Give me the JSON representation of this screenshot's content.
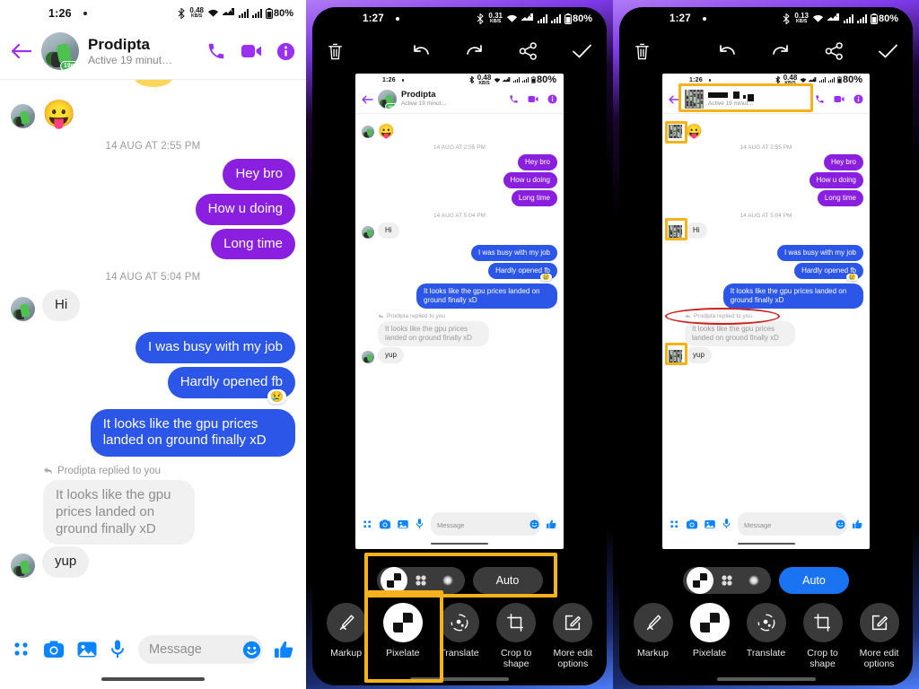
{
  "panels": {
    "left": {
      "name": "messenger-chat-fullscreen",
      "status_bar": {
        "time": "1:26",
        "net_speed": "0.48",
        "net_unit": "KB/S",
        "battery": "80%"
      },
      "header": {
        "contact_name": "Prodipta",
        "active_status": "Active 19 minut…",
        "avatar_badge": "19m",
        "back_icon": "back-arrow-icon",
        "call_icon": "phone-call-icon",
        "video_icon": "video-call-icon",
        "info_icon": "info-icon"
      },
      "messages": [
        {
          "type": "emoji",
          "side": "in",
          "text": "😛"
        },
        {
          "type": "timestamp",
          "text": "14 AUG AT 2:55 PM"
        },
        {
          "type": "bubble",
          "side": "out",
          "color": "purple",
          "text": "Hey bro"
        },
        {
          "type": "bubble",
          "side": "out",
          "color": "purple",
          "text": "How u doing"
        },
        {
          "type": "bubble",
          "side": "out",
          "color": "purple",
          "text": "Long time"
        },
        {
          "type": "timestamp",
          "text": "14 AUG AT 5:04 PM"
        },
        {
          "type": "bubble",
          "side": "in",
          "color": "grey",
          "text": "Hi"
        },
        {
          "type": "bubble",
          "side": "out",
          "color": "blue",
          "text": "I was busy with my job"
        },
        {
          "type": "bubble",
          "side": "out",
          "color": "blue",
          "text": "Hardly opened fb",
          "reaction": "😢"
        },
        {
          "type": "bubble",
          "side": "out",
          "color": "blue",
          "text": "It looks like the gpu prices landed on ground finally xD"
        },
        {
          "type": "reply_label",
          "text": "Prodipta replied to you"
        },
        {
          "type": "bubble",
          "side": "in",
          "color": "quoted",
          "text": "It looks like the gpu prices landed on ground finally xD"
        },
        {
          "type": "bubble",
          "side": "in",
          "color": "grey",
          "text": "yup"
        }
      ],
      "composer": {
        "placeholder": "Message",
        "apps_icon": "apps-grid-icon",
        "camera_icon": "camera-icon",
        "gallery_icon": "gallery-image-icon",
        "mic_icon": "microphone-icon",
        "sticker_icon": "smiley-sticker-icon",
        "like_icon": "thumbs-up-icon"
      }
    },
    "middle": {
      "name": "photo-editor-pixelate-tool-selected",
      "status_bar": {
        "time": "1:27",
        "net_speed": "0.31",
        "net_unit": "KB/S",
        "battery": "80%"
      },
      "toolbar": {
        "delete_icon": "trash-can-icon",
        "undo_icon": "undo-arrow-icon",
        "redo_icon": "redo-arrow-icon",
        "share_icon": "share-nodes-icon",
        "done_icon": "checkmark-icon"
      },
      "style_options": [
        {
          "name": "mosaic-block-style",
          "selected": true
        },
        {
          "name": "dots-cluster-style",
          "selected": false
        },
        {
          "name": "blur-dot-style",
          "selected": false
        }
      ],
      "auto_button": {
        "label": "Auto",
        "active": false
      },
      "tools": [
        {
          "label": "Markup",
          "icon": "pen-markup-icon",
          "selected": false
        },
        {
          "label": "Pixelate",
          "icon": "pixelate-blocks-icon",
          "selected": true
        },
        {
          "label": "Translate",
          "icon": "translate-lens-icon",
          "selected": false
        },
        {
          "label": "Crop to shape",
          "icon": "crop-shape-icon",
          "selected": false
        },
        {
          "label": "More edit options",
          "icon": "edit-square-pencil-icon",
          "selected": false
        }
      ],
      "annotations": [
        {
          "type": "highlight-box",
          "name": "highlight-style-selector"
        },
        {
          "type": "highlight-box",
          "name": "highlight-pixelate-tool"
        }
      ]
    },
    "right": {
      "name": "photo-editor-pixelate-applied",
      "status_bar": {
        "time": "1:27",
        "net_speed": "0.13",
        "net_unit": "KB/S",
        "battery": "80%"
      },
      "toolbar": {
        "delete_icon": "trash-can-icon",
        "undo_icon": "undo-arrow-icon",
        "redo_icon": "redo-arrow-icon",
        "share_icon": "share-nodes-icon",
        "done_icon": "checkmark-icon"
      },
      "style_options": [
        {
          "name": "mosaic-block-style",
          "selected": true
        },
        {
          "name": "dots-cluster-style",
          "selected": false
        },
        {
          "name": "blur-dot-style",
          "selected": false
        }
      ],
      "auto_button": {
        "label": "Auto",
        "active": true
      },
      "tools": [
        {
          "label": "Markup",
          "icon": "pen-markup-icon",
          "selected": false
        },
        {
          "label": "Pixelate",
          "icon": "pixelate-blocks-icon",
          "selected": true
        },
        {
          "label": "Translate",
          "icon": "translate-lens-icon",
          "selected": false
        },
        {
          "label": "Crop to shape",
          "icon": "crop-shape-icon",
          "selected": false
        },
        {
          "label": "More edit options",
          "icon": "edit-square-pencil-icon",
          "selected": false
        }
      ],
      "annotations": [
        {
          "type": "highlight-box",
          "name": "highlight-pixelated-header-name"
        },
        {
          "type": "highlight-box",
          "name": "highlight-pixelated-avatar-1"
        },
        {
          "type": "highlight-box",
          "name": "highlight-pixelated-avatar-2"
        },
        {
          "type": "highlight-box",
          "name": "highlight-pixelated-avatar-3"
        },
        {
          "type": "red-ellipse",
          "name": "highlight-reply-label"
        }
      ],
      "reply_label_text": "Prodipta replied to you"
    }
  },
  "shared_colors": {
    "messenger_purple": "#8a1fe0",
    "messenger_blue": "#2b56e8",
    "accent_blue": "#1a73f0",
    "highlight_yellow": "#F5B21A",
    "ellipse_red": "#d0201b"
  }
}
